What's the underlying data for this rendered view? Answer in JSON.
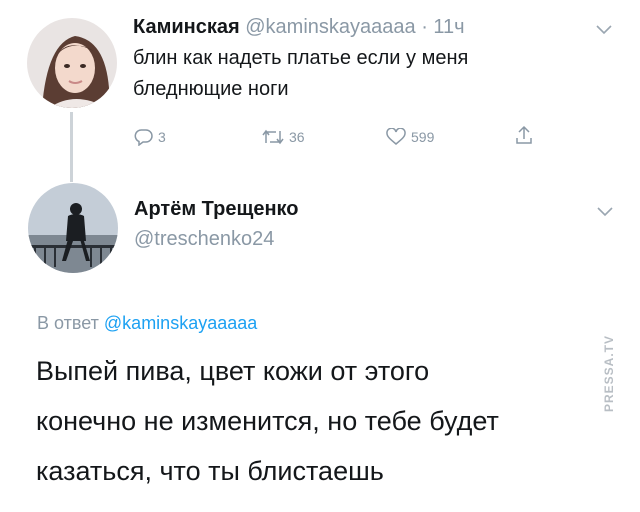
{
  "tweet": {
    "author_name": "Каминская",
    "author_handle": "@kaminskayaaaaa",
    "time": "· 11ч",
    "text_line1": "блин как надеть платье если у меня",
    "text_line2": "бледнющие ноги",
    "replies": "3",
    "retweets": "36",
    "likes": "599"
  },
  "reply": {
    "author_name": "Артём Трещенко",
    "author_handle": "@treschenko24",
    "reply_prefix": "В ответ",
    "reply_mention": "@kaminskayaaaaa",
    "text_line1": "Выпей пива, цвет кожи от этого",
    "text_line2": "конечно не изменится, но тебе будет",
    "text_line3": "казаться, что ты блистаешь"
  },
  "watermark": "PRESSA.TV",
  "colors": {
    "link": "#1da1f2",
    "muted": "#8a98a5",
    "thread_line": "#cdd3d8"
  },
  "icons": [
    "reply-icon",
    "retweet-icon",
    "like-icon",
    "share-icon",
    "chevron-down-icon"
  ]
}
